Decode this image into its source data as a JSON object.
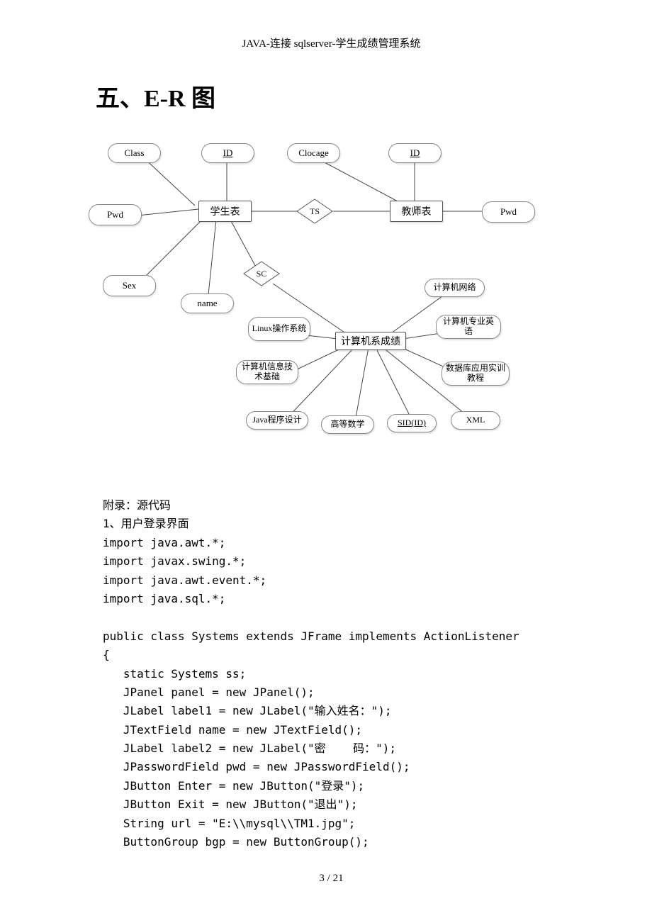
{
  "header": "JAVA-连接 sqlserver-学生成绩管理系统",
  "title": "五、E-R 图",
  "diagram": {
    "entities": {
      "student": "学生表",
      "teacher": "教师表",
      "grades": "计算机系成绩"
    },
    "relations": {
      "ts": "TS",
      "sc": "SC"
    },
    "attrs": {
      "class": "Class",
      "id1": "ID",
      "clocage": "Clocage",
      "id2": "ID",
      "pwd1": "Pwd",
      "pwd2": "Pwd",
      "sex": "Sex",
      "name": "name",
      "linux": "Linux操作系统",
      "cs_net": "计算机网络",
      "cs_eng": "计算机专业英语",
      "cs_info": "计算机信息技术基础",
      "db_train": "数据库应用实训教程",
      "java_prog": "Java程序设计",
      "adv_math": "高等数学",
      "sid": "SID(ID)",
      "xml": "XML"
    }
  },
  "code": {
    "l1": "附录：源代码",
    "l2": "1、用户登录界面",
    "l3": "import java.awt.*;",
    "l4": "import javax.swing.*;",
    "l5": "import java.awt.event.*;",
    "l6": "import java.sql.*;",
    "l7": "",
    "l8": "public class Systems extends JFrame implements ActionListener",
    "l9": "{",
    "l10": "   static Systems ss;",
    "l11": "   JPanel panel = new JPanel();",
    "l12": "   JLabel label1 = new JLabel(\"输入姓名：\");",
    "l13": "   JTextField name = new JTextField();",
    "l14": "   JLabel label2 = new JLabel(\"密    码：\");",
    "l15": "   JPasswordField pwd = new JPasswordField();",
    "l16": "   JButton Enter = new JButton(\"登录\");",
    "l17": "   JButton Exit = new JButton(\"退出\");",
    "l18": "   String url = \"E:\\\\mysql\\\\TM1.jpg\";",
    "l19": "   ButtonGroup bgp = new ButtonGroup();"
  },
  "footer": "3 / 21"
}
